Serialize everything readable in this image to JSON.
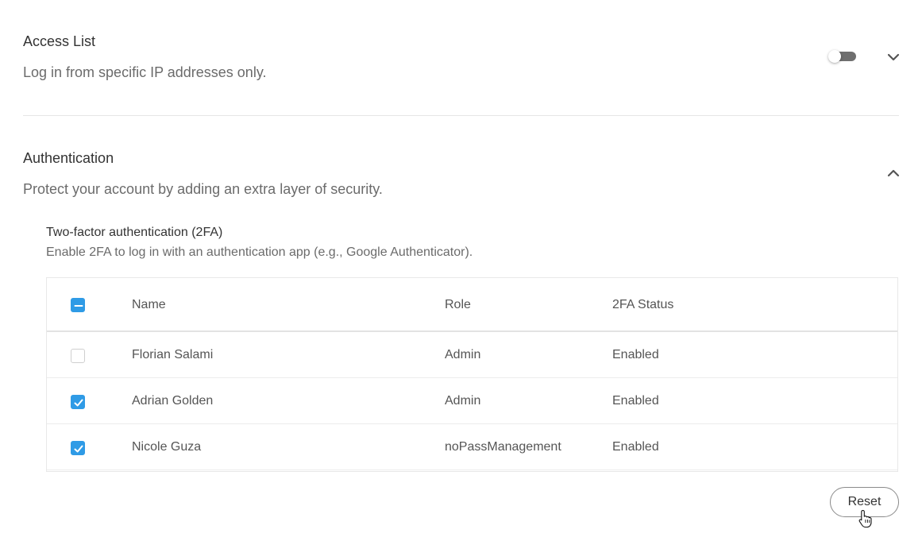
{
  "access_list": {
    "title": "Access List",
    "description": "Log in from specific IP addresses only.",
    "toggle_on": false,
    "expanded": false
  },
  "authentication": {
    "title": "Authentication",
    "description": "Protect your account by adding an extra layer of security.",
    "expanded": true,
    "two_factor": {
      "title": "Two-factor authentication (2FA)",
      "description": "Enable 2FA to log in with an authentication app (e.g., Google Authenticator)."
    }
  },
  "table": {
    "header_select_state": "indeterminate",
    "columns": {
      "name": "Name",
      "role": "Role",
      "status": "2FA Status"
    },
    "rows": [
      {
        "checked": false,
        "name": "Florian Salami",
        "role": "Admin",
        "status": "Enabled"
      },
      {
        "checked": true,
        "name": "Adrian Golden",
        "role": "Admin",
        "status": "Enabled"
      },
      {
        "checked": true,
        "name": "Nicole Guza",
        "role": "noPassManagement",
        "status": "Enabled"
      }
    ]
  },
  "actions": {
    "reset_label": "Reset"
  },
  "colors": {
    "accent": "#2f9be6",
    "toggle_off": "#6f6f6f"
  },
  "icons": {
    "access_list_chevron": "chevron-down-icon",
    "authentication_chevron": "chevron-up-icon",
    "pointer": "hand-pointer-cursor-icon"
  }
}
